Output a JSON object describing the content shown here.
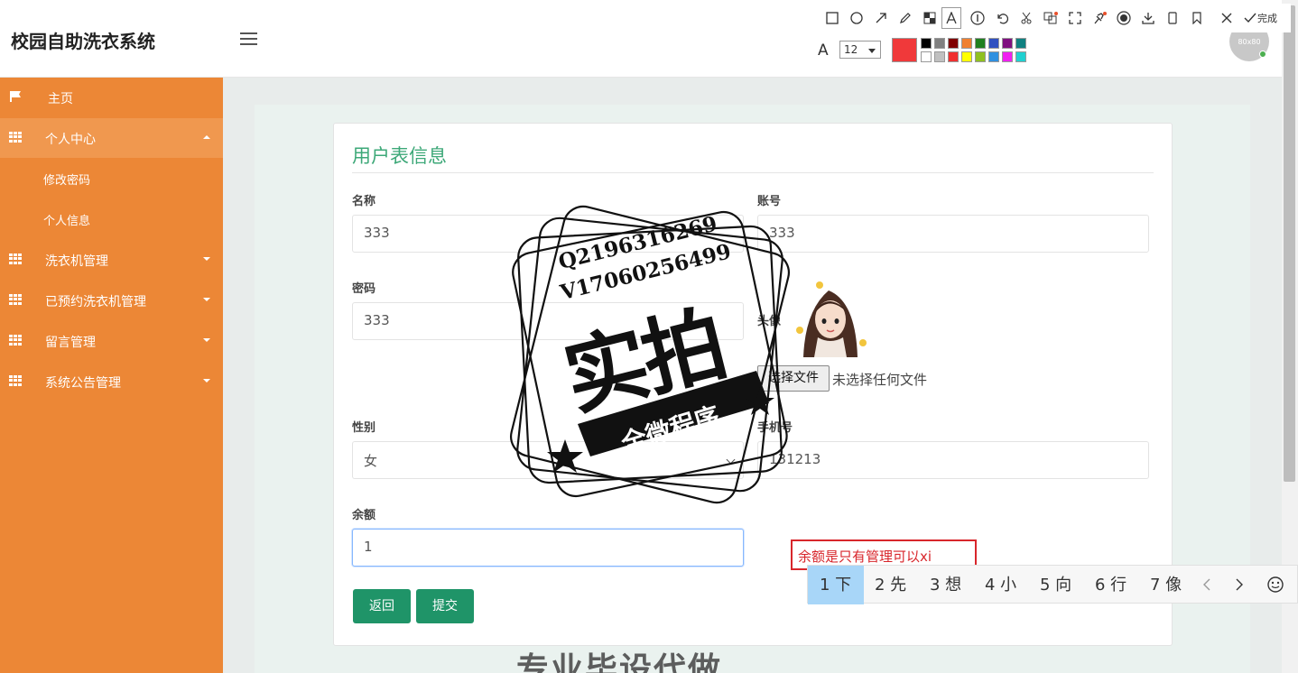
{
  "header": {
    "title": "校园自助洗衣系统",
    "avatar_text": "80x80"
  },
  "sidebar": {
    "items": [
      {
        "label": "主页"
      },
      {
        "label": "个人中心"
      },
      {
        "label": "洗衣机管理"
      },
      {
        "label": "已预约洗衣机管理"
      },
      {
        "label": "留言管理"
      },
      {
        "label": "系统公告管理"
      }
    ],
    "subitems": [
      {
        "label": "修改密码"
      },
      {
        "label": "个人信息"
      }
    ]
  },
  "form": {
    "title": "用户表信息",
    "name_label": "名称",
    "name_value": "333",
    "account_label": "账号",
    "account_value": "333",
    "password_label": "密码",
    "password_value": "333",
    "avatar_label": "头像",
    "file_button": "选择文件",
    "file_status": "未选择任何文件",
    "gender_label": "性别",
    "gender_value": "女",
    "phone_label": "手机号",
    "phone_value": "131213",
    "balance_label": "余额",
    "balance_value": "1",
    "back_button": "返回",
    "submit_button": "提交"
  },
  "watermark": {
    "qq": "Q2196316269",
    "wechat": "V17060256499",
    "main": "实拍",
    "banner": "全微程序",
    "bottom": "专业毕设代做"
  },
  "toolbar": {
    "finish_label": "完成",
    "font_size": "12"
  },
  "annotation": {
    "text": "余额是只有管理可以xi"
  },
  "ime": {
    "candidates": [
      {
        "label": "1 下"
      },
      {
        "label": "2 先"
      },
      {
        "label": "3 想"
      },
      {
        "label": "4 小"
      },
      {
        "label": "5 向"
      },
      {
        "label": "6 行"
      },
      {
        "label": "7 像"
      }
    ]
  },
  "colors": {
    "sidebar": "#ec8736",
    "accent": "#3da878",
    "button": "#1f9468",
    "annotation": "#d8262b"
  }
}
